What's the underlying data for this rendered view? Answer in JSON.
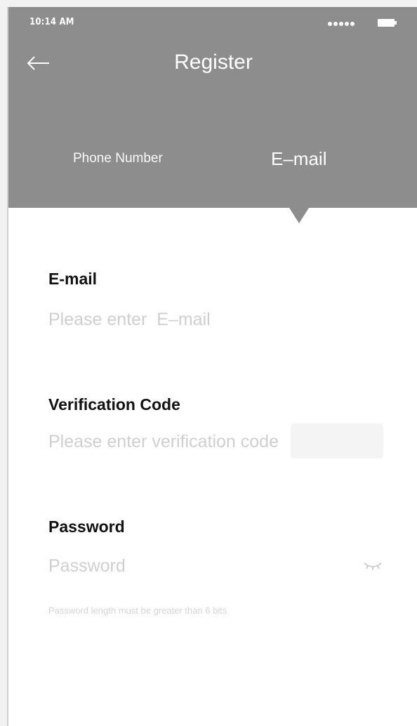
{
  "status_bar": {
    "time": "10:14 AM",
    "signal_icon": "signal-dots-icon",
    "battery_icon": "battery-icon"
  },
  "header": {
    "back_icon": "arrow-left-icon",
    "title": "Register",
    "background_color": "#8d8d8d"
  },
  "tabs": [
    {
      "label": "Phone Number",
      "selected": false
    },
    {
      "label": "E–mail",
      "selected": true
    }
  ],
  "form": {
    "email": {
      "label": "E-mail",
      "placeholder": "Please enter  E–mail",
      "value": ""
    },
    "verification_code": {
      "label": "Verification Code",
      "placeholder": "Please enter verification code",
      "value": ""
    },
    "password": {
      "label": "Password",
      "placeholder": "Password",
      "value": "",
      "visibility_icon": "eye-closed-icon",
      "hint": "Password length must be greater than 6 bits"
    }
  }
}
